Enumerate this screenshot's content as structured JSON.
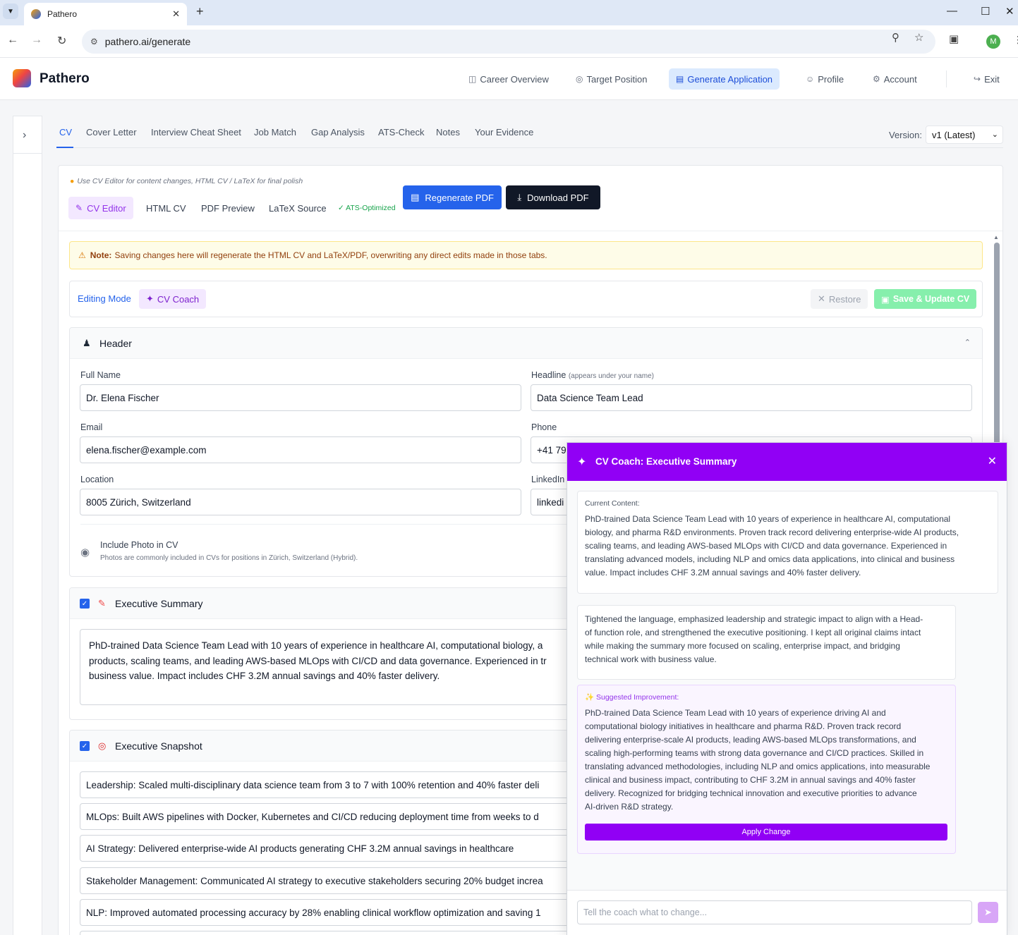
{
  "browser": {
    "tab_title": "Pathero",
    "url": "pathero.ai/generate",
    "profile_initial": "M"
  },
  "app": {
    "brand": "Pathero",
    "nav": [
      {
        "label": "Career Overview",
        "icon": "briefcase-icon"
      },
      {
        "label": "Target Position",
        "icon": "target-icon"
      },
      {
        "label": "Generate Application",
        "icon": "document-icon",
        "active": true
      },
      {
        "label": "Profile",
        "icon": "user-icon"
      },
      {
        "label": "Account",
        "icon": "gear-icon"
      },
      {
        "label": "Exit",
        "icon": "logout-icon"
      }
    ]
  },
  "tabs": [
    "CV",
    "Cover Letter",
    "Interview Cheat Sheet",
    "Job Match",
    "Gap Analysis",
    "ATS-Check",
    "Notes",
    "Your Evidence"
  ],
  "version": {
    "label": "Version:",
    "selected": "v1 (Latest)"
  },
  "editor": {
    "hint": "Use CV Editor for content changes, HTML CV / LaTeX for final polish",
    "subtabs": [
      "CV Editor",
      "HTML CV",
      "PDF Preview",
      "LaTeX Source"
    ],
    "ats_badge": "ATS-Optimized",
    "regenerate_label": "Regenerate PDF",
    "download_label": "Download PDF",
    "note_bold": "Note:",
    "note_text": "Saving changes here will regenerate the HTML CV and LaTeX/PDF, overwriting any direct edits made in those tabs.",
    "mode_label": "Editing Mode",
    "coach_label": "CV Coach",
    "restore_label": "Restore",
    "save_label": "Save & Update CV"
  },
  "header_section": {
    "title": "Header",
    "full_name_label": "Full Name",
    "full_name": "Dr. Elena Fischer",
    "headline_label": "Headline",
    "headline_hint": "(appears under your name)",
    "headline": "Data Science Team Lead",
    "email_label": "Email",
    "email": "elena.fischer@example.com",
    "phone_label": "Phone",
    "phone": "+41 79",
    "location_label": "Location",
    "location": "8005 Zürich, Switzerland",
    "linkedin_label": "LinkedIn",
    "linkedin": "linkedi",
    "photo_title": "Include Photo in CV",
    "photo_sub": "Photos are commonly included in CVs for positions in Zürich, Switzerland (Hybrid)."
  },
  "summary_section": {
    "title": "Executive Summary",
    "lines": [
      "PhD-trained Data Science Team Lead with 10 years of experience in healthcare AI, computational biology, a",
      "products, scaling teams, and leading AWS-based MLOps with CI/CD and data governance. Experienced in tr",
      "business value. Impact includes CHF 3.2M annual savings and 40% faster delivery."
    ]
  },
  "snapshot_section": {
    "title": "Executive Snapshot",
    "items": [
      "Leadership: Scaled multi-disciplinary data science team from 3 to 7 with 100% retention and 40% faster deli",
      "MLOps: Built AWS pipelines with Docker, Kubernetes and CI/CD reducing deployment time from weeks to d",
      "AI Strategy: Delivered enterprise-wide AI products generating CHF 3.2M annual savings in healthcare",
      "Stakeholder Management: Communicated AI strategy to executive stakeholders securing 20% budget increa",
      "NLP: Improved automated processing accuracy by 28% enabling clinical workflow optimization and saving 1"
    ]
  },
  "coach": {
    "title": "CV Coach: Executive Summary",
    "current_label": "Current Content:",
    "current_lines": [
      "PhD-trained Data Science Team Lead with 10 years of experience in healthcare AI, computational",
      "biology, and pharma R&D environments. Proven track record delivering enterprise-wide AI products,",
      "scaling teams, and leading AWS-based MLOps with CI/CD and data governance. Experienced in",
      "translating advanced models, including NLP and omics data applications, into clinical and business",
      "value. Impact includes CHF 3.2M annual savings and 40% faster delivery."
    ],
    "reply_lines": [
      "Tightened the language, emphasized leadership and strategic impact to align with a Head-",
      "of function role, and strengthened the executive positioning. I kept all original claims intact",
      "while making the summary more focused on scaling, enterprise impact, and bridging",
      "technical work with business value."
    ],
    "suggest_label": "Suggested Improvement:",
    "suggest_lines": [
      "PhD-trained Data Science Team Lead with 10 years of experience driving AI and",
      "computational biology initiatives in healthcare and pharma R&D. Proven track record",
      "delivering enterprise-scale AI products, leading AWS-based MLOps transformations, and",
      "scaling high-performing teams with strong data governance and CI/CD practices. Skilled in",
      "translating advanced methodologies, including NLP and omics applications, into measurable",
      "clinical and business impact, contributing to CHF 3.2M in annual savings and 40% faster",
      "delivery. Recognized for bridging technical innovation and executive priorities to advance",
      "AI-driven R&D strategy."
    ],
    "apply_label": "Apply Change",
    "input_placeholder": "Tell the coach what to change..."
  },
  "colors": {
    "primary": "#2563eb",
    "coach_purple": "#9100f5",
    "note_bg": "#fefce8"
  }
}
